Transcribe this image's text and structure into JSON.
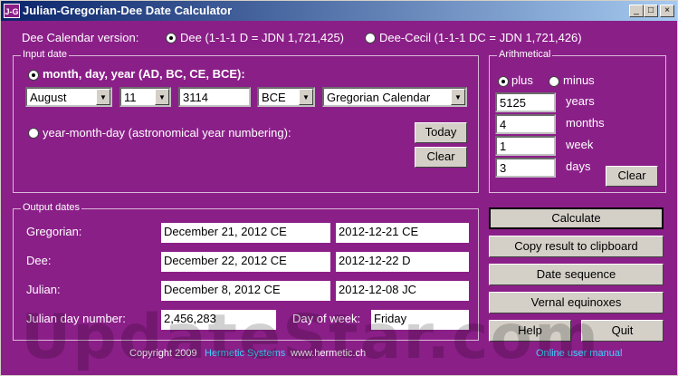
{
  "window": {
    "icon_text": "J-G",
    "title": "Julian-Gregorian-Dee Date Calculator",
    "minimize": "_",
    "maximize": "□",
    "close": "×"
  },
  "dee_version": {
    "label": "Dee Calendar version:",
    "option_dee": "Dee (1-1-1 D = JDN 1,721,425)",
    "option_dee_cecil": "Dee-Cecil (1-1-1 DC = JDN 1,721,426)",
    "selected": "dee"
  },
  "input_date": {
    "group_title": "Input date",
    "mode_mdy": "month, day, year (AD, BC, CE, BCE):",
    "month": "August",
    "day": "11",
    "year": "3114",
    "era": "BCE",
    "calendar": "Gregorian Calendar",
    "mode_ymd": "year-month-day (astronomical year numbering):",
    "today_button": "Today",
    "clear_button": "Clear"
  },
  "arithmetic": {
    "group_title": "Arithmetical",
    "plus": "plus",
    "minus": "minus",
    "years_value": "5125",
    "years_label": "years",
    "months_value": "4",
    "months_label": "months",
    "week_value": "1",
    "week_label": "week",
    "days_value": "3",
    "days_label": "days",
    "clear_button": "Clear"
  },
  "output_dates": {
    "group_title": "Output dates",
    "gregorian_label": "Gregorian:",
    "gregorian_long": "December 21, 2012 CE",
    "gregorian_short": "2012-12-21 CE",
    "dee_label": "Dee:",
    "dee_long": "December 22, 2012 CE",
    "dee_short": "2012-12-22 D",
    "julian_label": "Julian:",
    "julian_long": "December 8, 2012 CE",
    "julian_short": "2012-12-08 JC",
    "jdn_label": "Julian day number:",
    "jdn_value": "2,456,283",
    "dow_label": "Day of week:",
    "dow_value": "Friday"
  },
  "actions": {
    "calculate": "Calculate",
    "copy": "Copy result to clipboard",
    "date_sequence": "Date sequence",
    "vernal_equinoxes": "Vernal equinoxes",
    "help": "Help",
    "quit": "Quit"
  },
  "footer": {
    "copyright": "Copyright 2009",
    "company": "Hermetic Systems",
    "website": "www.hermetic.ch",
    "manual": "Online user manual"
  },
  "watermark": "UpdateStar.com",
  "colors": {
    "background": "#8b1f88",
    "link": "#3fd2ff"
  }
}
